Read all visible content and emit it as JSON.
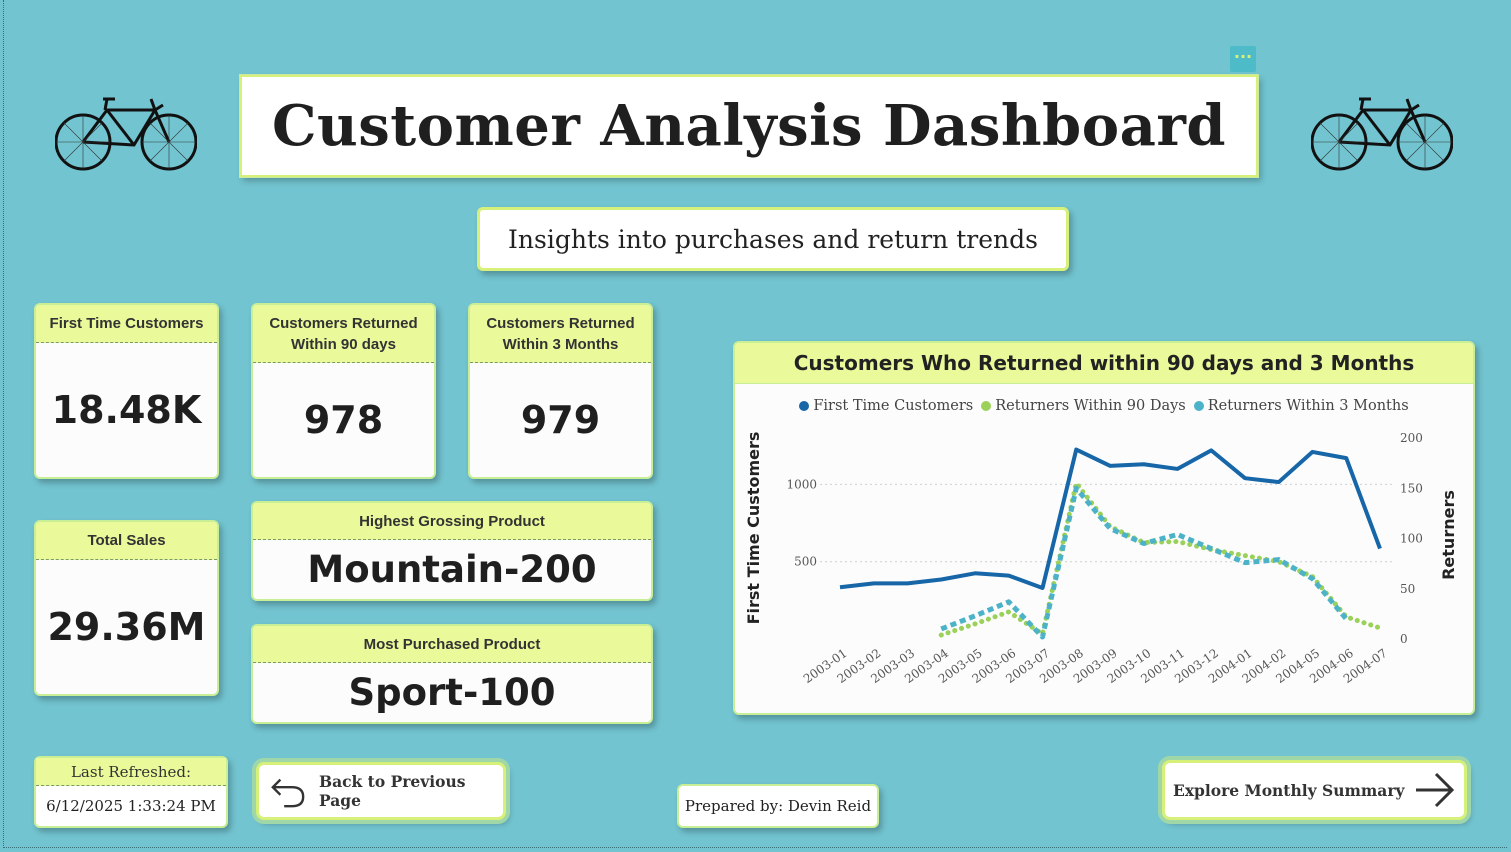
{
  "header": {
    "title": "Customer Analysis Dashboard",
    "subtitle": "Insights into purchases and return trends",
    "more_options": "···"
  },
  "kpis": {
    "first_time": {
      "label": "First Time Customers",
      "value": "18.48K"
    },
    "returned_90": {
      "label": "Customers Returned Within 90 days",
      "value": "978"
    },
    "returned_3m": {
      "label": "Customers Returned Within 3 Months",
      "value": "979"
    },
    "total_sales": {
      "label": "Total Sales",
      "value": "29.36M"
    },
    "highest_grossing": {
      "label": "Highest Grossing Product",
      "value": "Mountain-200"
    },
    "most_purchased": {
      "label": "Most Purchased Product",
      "value": "Sport-100"
    }
  },
  "refresh": {
    "label": "Last Refreshed:",
    "value": "6/12/2025 1:33:24 PM"
  },
  "nav": {
    "back_label": "Back to Previous Page",
    "next_label": "Explore Monthly Summary"
  },
  "prepared_by": "Prepared by: Devin Reid",
  "icons": {
    "bike_left": "bicycle-icon",
    "bike_right": "bicycle-icon",
    "back": "back-arrow-icon",
    "next": "right-arrow-icon"
  },
  "colors": {
    "background": "#72c4d0",
    "accent": "#eaf99a",
    "first_time": "#1666a8",
    "ret90": "#9bd158",
    "ret3m": "#4cb2c8"
  },
  "chart_data": {
    "type": "line",
    "title": "Customers Who Returned within 90 days and 3 Months",
    "ylabel": "First Time Customers",
    "y2label": "Returners",
    "categories": [
      "2003-01",
      "2003-02",
      "2003-03",
      "2003-04",
      "2003-05",
      "2003-06",
      "2003-07",
      "2003-08",
      "2003-09",
      "2003-10",
      "2003-11",
      "2003-12",
      "2004-01",
      "2004-02",
      "2004-05",
      "2004-06",
      "2004-07"
    ],
    "y_ticks": [
      "500",
      "1000"
    ],
    "y2_ticks": [
      "0",
      "50",
      "100",
      "150",
      "200"
    ],
    "ylim": [
      0,
      1300
    ],
    "y2lim": [
      0,
      200
    ],
    "legend_position": "top",
    "series": [
      {
        "name": "First Time Customers",
        "axis": "left",
        "color": "#1666a8",
        "style": "solid",
        "values": [
          335,
          360,
          360,
          385,
          425,
          410,
          330,
          1225,
          1120,
          1130,
          1100,
          1220,
          1040,
          1015,
          1210,
          1170,
          585
        ]
      },
      {
        "name": "Returners Within 90 Days",
        "axis": "right",
        "color": "#9bd158",
        "style": "dotted",
        "values": [
          null,
          null,
          null,
          4,
          15,
          27,
          5,
          155,
          112,
          96,
          97,
          89,
          83,
          77,
          62,
          22,
          11
        ]
      },
      {
        "name": "Returners Within 3 Months",
        "axis": "right",
        "color": "#4cb2c8",
        "style": "dashed",
        "values": [
          null,
          null,
          null,
          10,
          23,
          37,
          2,
          150,
          110,
          95,
          104,
          90,
          76,
          79,
          60,
          20,
          null
        ]
      }
    ]
  }
}
